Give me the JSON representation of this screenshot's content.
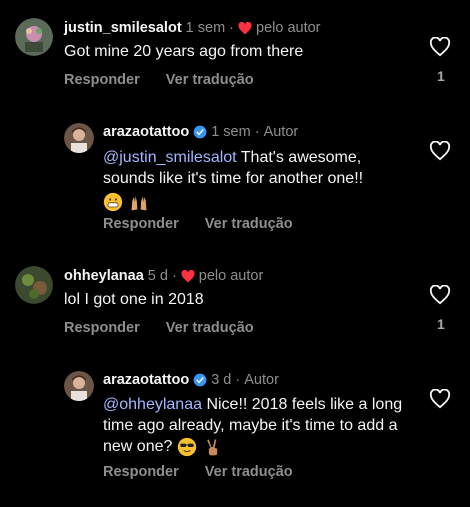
{
  "comments": [
    {
      "username": "justin_smilesalot",
      "time": "1 sem",
      "liked_by_author": "pelo autor",
      "text": "Got mine 20 years ago from there",
      "reply": "Responder",
      "translate": "Ver tradução",
      "like_count": "1"
    },
    {
      "username": "arazaotattoo",
      "time": "1 sem",
      "role": "Autor",
      "mention": "@justin_smilesalot",
      "text": "That's awesome, sounds like it's time for another one!!",
      "emojis": [
        "grinning-face-emoji",
        "raised-hands-emoji"
      ],
      "reply": "Responder",
      "translate": "Ver tradução"
    },
    {
      "username": "ohheylanaa",
      "time": "5 d",
      "liked_by_author": "pelo autor",
      "text": "lol I got one in 2018",
      "reply": "Responder",
      "translate": "Ver tradução",
      "like_count": "1"
    },
    {
      "username": "arazaotattoo",
      "time": "3 d",
      "role": "Autor",
      "mention": "@ohheylanaa",
      "text": "Nice!! 2018 feels like a long time ago already, maybe it's time to add a new one?",
      "emojis": [
        "sunglasses-face-emoji",
        "victory-hand-emoji"
      ],
      "reply": "Responder",
      "translate": "Ver tradução"
    }
  ],
  "colors": {
    "background": "#000000",
    "mention": "#a3b6ff",
    "heart_red": "#ff3040",
    "verified_blue": "#3897f0",
    "muted": "#8e8e8e"
  }
}
